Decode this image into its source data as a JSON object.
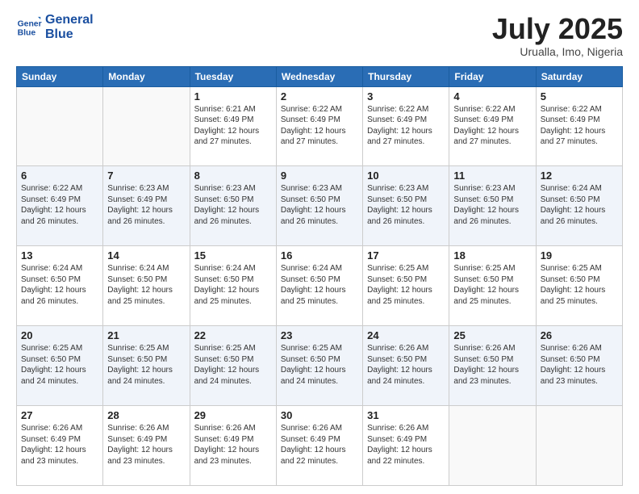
{
  "logo": {
    "line1": "General",
    "line2": "Blue"
  },
  "title": "July 2025",
  "location": "Urualla, Imo, Nigeria",
  "days_of_week": [
    "Sunday",
    "Monday",
    "Tuesday",
    "Wednesday",
    "Thursday",
    "Friday",
    "Saturday"
  ],
  "weeks": [
    [
      {
        "day": "",
        "info": ""
      },
      {
        "day": "",
        "info": ""
      },
      {
        "day": "1",
        "info": "Sunrise: 6:21 AM\nSunset: 6:49 PM\nDaylight: 12 hours and 27 minutes."
      },
      {
        "day": "2",
        "info": "Sunrise: 6:22 AM\nSunset: 6:49 PM\nDaylight: 12 hours and 27 minutes."
      },
      {
        "day": "3",
        "info": "Sunrise: 6:22 AM\nSunset: 6:49 PM\nDaylight: 12 hours and 27 minutes."
      },
      {
        "day": "4",
        "info": "Sunrise: 6:22 AM\nSunset: 6:49 PM\nDaylight: 12 hours and 27 minutes."
      },
      {
        "day": "5",
        "info": "Sunrise: 6:22 AM\nSunset: 6:49 PM\nDaylight: 12 hours and 27 minutes."
      }
    ],
    [
      {
        "day": "6",
        "info": "Sunrise: 6:22 AM\nSunset: 6:49 PM\nDaylight: 12 hours and 26 minutes."
      },
      {
        "day": "7",
        "info": "Sunrise: 6:23 AM\nSunset: 6:49 PM\nDaylight: 12 hours and 26 minutes."
      },
      {
        "day": "8",
        "info": "Sunrise: 6:23 AM\nSunset: 6:50 PM\nDaylight: 12 hours and 26 minutes."
      },
      {
        "day": "9",
        "info": "Sunrise: 6:23 AM\nSunset: 6:50 PM\nDaylight: 12 hours and 26 minutes."
      },
      {
        "day": "10",
        "info": "Sunrise: 6:23 AM\nSunset: 6:50 PM\nDaylight: 12 hours and 26 minutes."
      },
      {
        "day": "11",
        "info": "Sunrise: 6:23 AM\nSunset: 6:50 PM\nDaylight: 12 hours and 26 minutes."
      },
      {
        "day": "12",
        "info": "Sunrise: 6:24 AM\nSunset: 6:50 PM\nDaylight: 12 hours and 26 minutes."
      }
    ],
    [
      {
        "day": "13",
        "info": "Sunrise: 6:24 AM\nSunset: 6:50 PM\nDaylight: 12 hours and 26 minutes."
      },
      {
        "day": "14",
        "info": "Sunrise: 6:24 AM\nSunset: 6:50 PM\nDaylight: 12 hours and 25 minutes."
      },
      {
        "day": "15",
        "info": "Sunrise: 6:24 AM\nSunset: 6:50 PM\nDaylight: 12 hours and 25 minutes."
      },
      {
        "day": "16",
        "info": "Sunrise: 6:24 AM\nSunset: 6:50 PM\nDaylight: 12 hours and 25 minutes."
      },
      {
        "day": "17",
        "info": "Sunrise: 6:25 AM\nSunset: 6:50 PM\nDaylight: 12 hours and 25 minutes."
      },
      {
        "day": "18",
        "info": "Sunrise: 6:25 AM\nSunset: 6:50 PM\nDaylight: 12 hours and 25 minutes."
      },
      {
        "day": "19",
        "info": "Sunrise: 6:25 AM\nSunset: 6:50 PM\nDaylight: 12 hours and 25 minutes."
      }
    ],
    [
      {
        "day": "20",
        "info": "Sunrise: 6:25 AM\nSunset: 6:50 PM\nDaylight: 12 hours and 24 minutes."
      },
      {
        "day": "21",
        "info": "Sunrise: 6:25 AM\nSunset: 6:50 PM\nDaylight: 12 hours and 24 minutes."
      },
      {
        "day": "22",
        "info": "Sunrise: 6:25 AM\nSunset: 6:50 PM\nDaylight: 12 hours and 24 minutes."
      },
      {
        "day": "23",
        "info": "Sunrise: 6:25 AM\nSunset: 6:50 PM\nDaylight: 12 hours and 24 minutes."
      },
      {
        "day": "24",
        "info": "Sunrise: 6:26 AM\nSunset: 6:50 PM\nDaylight: 12 hours and 24 minutes."
      },
      {
        "day": "25",
        "info": "Sunrise: 6:26 AM\nSunset: 6:50 PM\nDaylight: 12 hours and 23 minutes."
      },
      {
        "day": "26",
        "info": "Sunrise: 6:26 AM\nSunset: 6:50 PM\nDaylight: 12 hours and 23 minutes."
      }
    ],
    [
      {
        "day": "27",
        "info": "Sunrise: 6:26 AM\nSunset: 6:49 PM\nDaylight: 12 hours and 23 minutes."
      },
      {
        "day": "28",
        "info": "Sunrise: 6:26 AM\nSunset: 6:49 PM\nDaylight: 12 hours and 23 minutes."
      },
      {
        "day": "29",
        "info": "Sunrise: 6:26 AM\nSunset: 6:49 PM\nDaylight: 12 hours and 23 minutes."
      },
      {
        "day": "30",
        "info": "Sunrise: 6:26 AM\nSunset: 6:49 PM\nDaylight: 12 hours and 22 minutes."
      },
      {
        "day": "31",
        "info": "Sunrise: 6:26 AM\nSunset: 6:49 PM\nDaylight: 12 hours and 22 minutes."
      },
      {
        "day": "",
        "info": ""
      },
      {
        "day": "",
        "info": ""
      }
    ]
  ]
}
